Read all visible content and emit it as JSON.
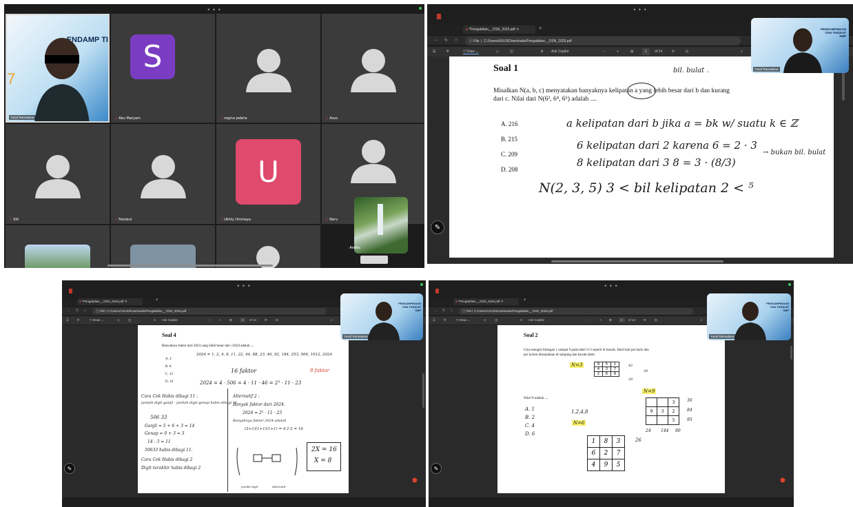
{
  "meeting": {
    "dots": "• • •",
    "participants": [
      {
        "name": "Yusuf Ramadana"
      },
      {
        "name": "Abu Maryam",
        "initial": "S"
      },
      {
        "name": "regina pebria"
      },
      {
        "name": "Asus"
      },
      {
        "name": "Siti"
      },
      {
        "name": "Faizatul"
      },
      {
        "name": "Ukhty Ummaya",
        "initial": "U"
      },
      {
        "name": "Nerv"
      }
    ],
    "floating_name": "Andika",
    "banner_text": "ENDAMP TI"
  },
  "browser": {
    "tab_title": "*Pengabdian__OSN_2025.pdf",
    "url_label": "File",
    "url_path_full": "C:/Users/ASUS/Downloads/Pengabdian__OSN_2025.pdf",
    "url_path_short": "C:/Users/ASUS/Downloads/Pengabdian__OSN_2025.pdf",
    "toolbar": {
      "draw": "Draw",
      "ask_copilot": "Ask Copilot",
      "of_pages": "of 14"
    },
    "pages": {
      "tr": "1",
      "bl": "4",
      "br": "2"
    },
    "presenter": "Yusuf Ramadana",
    "cam_banner": "PENDAMPINGAN OSN TINGKAT SMP"
  },
  "soal1": {
    "title": "Soal 1",
    "text1": "Misalkan N(a, b, c) menyatakan banyaknya kelipatan a yang lebih besar dari b dan kurang",
    "text2": "dari c. Nilai dari N(6³, 6⁴, 6⁶) adalah ....",
    "options": [
      "A. 216",
      "B. 215",
      "C. 209",
      "D. 208"
    ],
    "notes": [
      "bil. bulat .",
      "a kelipatan dari b jika   a = bk  w/ suatu k ∈ ℤ",
      "6 kelipatan dari 2 karena  6 = 2 · 3",
      "8 kelipatan dari 3      8 = 3 · (8/3)",
      "→ bukan bil. bulat",
      "N(2, 3, 5)    3 < bil kelipatan 2 < ⁵"
    ]
  },
  "soal4": {
    "title": "Soal 4",
    "text": "Banyaknya faktor dari 2024 yang lebih besar dari √2024 adalah ....",
    "options": [
      "A. 4",
      "B. 8",
      "C. 12",
      "D. 16"
    ],
    "notes": [
      "2024 = 1, 2, 4, 8, 11, 22, 44, 88, 23, 46, 92, 184, 253, 506, 1012, 2024",
      "16 faktor",
      "8 faktor",
      "2024 = 4 · 506 = 4 · 11 · 46 = 2³ · 11 · 23",
      "Cara Cek Habis dibagi 11 :",
      "jumlah digit ganjil - jumlah digit genap habis dibagi 11",
      "506 33",
      "Ganjil = 5 + 6 + 3 = 14",
      "Genap = 0 + 3 = 3",
      "14 - 3 = 11",
      "50633 habis dibagi 11.",
      "Cara Cek Habis dibagi 2",
      "Digit terakhir habis dibagi 2",
      "Alternatif 2 :",
      "Banyak faktor dari 2024.",
      "2024 = 2³ · 11 · 23",
      "Banyaknya faktor 2024 adalah",
      "(3+1)(1+1)(1+1) = 4·2·2 = 16",
      "2X = 16",
      "X = 8",
      "jumlah digit",
      "Alternatif"
    ]
  },
  "soal2": {
    "title": "Soal 2",
    "text1": "Gina mengisi bilangan 1 sampai 9 pada tabel 3×3 seperti di bawah. Hasil kali per baris dan",
    "text2": "per kolom ditunjukkan di samping dan bawah tabel.",
    "nilai": "Nilai N adalah ....",
    "options": [
      "A. 1",
      "B. 2",
      "C. 4",
      "D. 6"
    ],
    "grid_small": [
      [
        "9",
        "5",
        "1"
      ],
      [
        "4",
        "3",
        "7"
      ],
      [
        "2",
        "6",
        "8"
      ]
    ],
    "grid_bottom": [
      [
        "1",
        "8",
        "3"
      ],
      [
        "6",
        "2",
        "7"
      ],
      [
        "4",
        "9",
        "5"
      ]
    ],
    "grid_right": [
      [
        "",
        "",
        "3"
      ],
      [
        "9",
        "3",
        "2"
      ],
      [
        "",
        "",
        "5"
      ]
    ],
    "notes": [
      "N=3",
      "N=9",
      "N=6",
      "1,2,4,8",
      "26",
      "84",
      "95",
      "24",
      "144",
      "90",
      "36",
      "42",
      "30",
      "20"
    ]
  }
}
